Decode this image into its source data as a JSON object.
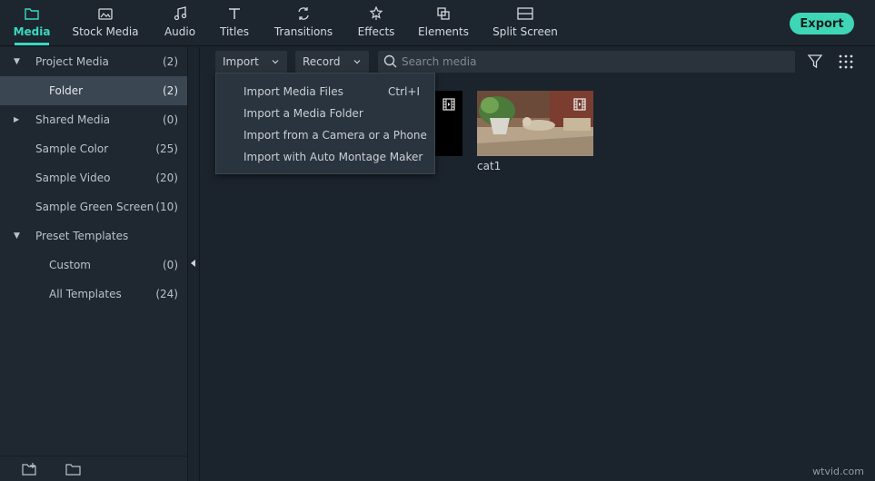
{
  "tabs": [
    {
      "label": "Media",
      "icon": "folder-icon",
      "active": true
    },
    {
      "label": "Stock Media",
      "icon": "stock-media-icon"
    },
    {
      "label": "Audio",
      "icon": "music-note-icon"
    },
    {
      "label": "Titles",
      "icon": "text-icon"
    },
    {
      "label": "Transitions",
      "icon": "transitions-icon"
    },
    {
      "label": "Effects",
      "icon": "effects-icon"
    },
    {
      "label": "Elements",
      "icon": "elements-icon"
    },
    {
      "label": "Split Screen",
      "icon": "split-screen-icon"
    }
  ],
  "export_label": "Export",
  "sidebar": {
    "items": [
      {
        "label": "Project Media",
        "count": "(2)",
        "expanded": true
      },
      {
        "label": "Folder",
        "count": "(2)",
        "selected": true
      },
      {
        "label": "Shared Media",
        "count": "(0)",
        "expanded": false
      },
      {
        "label": "Sample Color",
        "count": "(25)"
      },
      {
        "label": "Sample Video",
        "count": "(20)"
      },
      {
        "label": "Sample Green Screen",
        "count": "(10)"
      },
      {
        "label": "Preset Templates",
        "count": "",
        "expanded": true
      },
      {
        "label": "Custom",
        "count": "(0)"
      },
      {
        "label": "All Templates",
        "count": "(24)"
      }
    ]
  },
  "toolbar": {
    "import_label": "Import",
    "record_label": "Record",
    "search_placeholder": "Search media"
  },
  "import_menu": [
    {
      "label": "Import Media Files",
      "shortcut": "Ctrl+I"
    },
    {
      "label": "Import a Media Folder",
      "shortcut": ""
    },
    {
      "label": "Import from a Camera or a Phone",
      "shortcut": ""
    },
    {
      "label": "Import with Auto Montage Maker",
      "shortcut": ""
    }
  ],
  "media": [
    {
      "label": ""
    },
    {
      "label": "cat1"
    }
  ],
  "watermark": "wtvid.com",
  "colors": {
    "accent": "#38d9c1",
    "export_bg": "#3ed6b7",
    "background": "#1b232c",
    "sidebar_selected": "#3a4651"
  }
}
